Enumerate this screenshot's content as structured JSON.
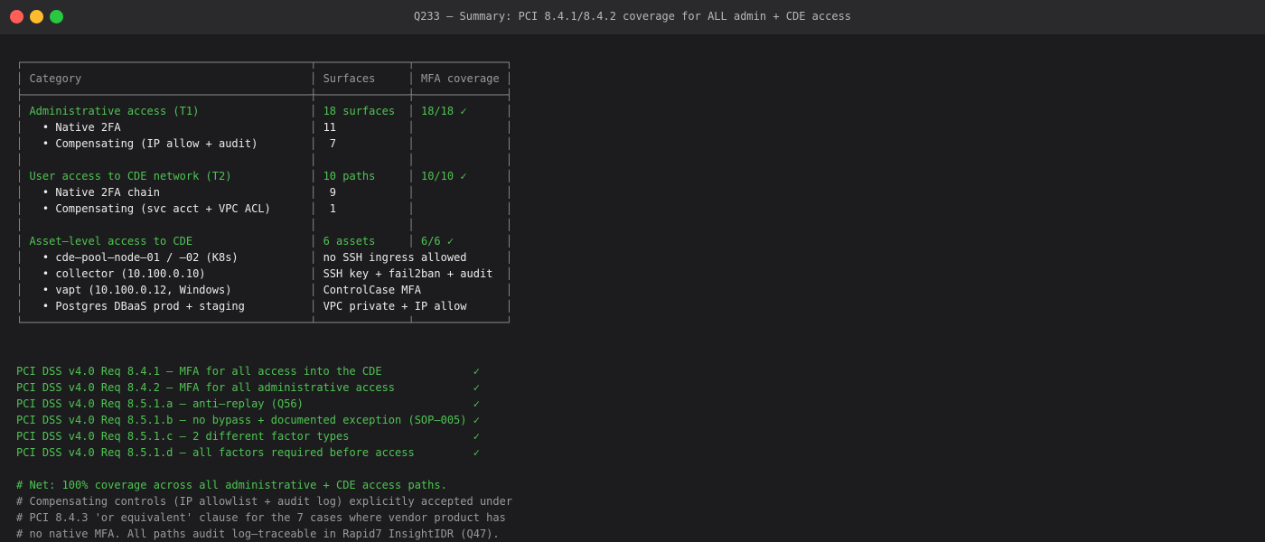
{
  "window": {
    "title": "Q233 — Summary: PCI 8.4.1/8.4.2 coverage for ALL admin + CDE access",
    "controls": {
      "close_color": "#ff5f57",
      "minimize_color": "#febc2e",
      "zoom_color": "#28c840"
    }
  },
  "colors": {
    "accent_green": "#4ec452",
    "text": "#ececec",
    "comment": "#9a9a9a",
    "background": "#1c1c1e"
  },
  "table": {
    "headers": [
      "Category",
      "Surfaces",
      "MFA coverage"
    ],
    "groups": [
      {
        "category": "Administrative access (T1)",
        "surfaces": "18 surfaces",
        "coverage": "18/18 ✓",
        "items": [
          {
            "label": "• Native 2FA",
            "value": "11"
          },
          {
            "label": "• Compensating (IP allow + audit)",
            "value": " 7"
          }
        ]
      },
      {
        "category": "User access to CDE network (T2)",
        "surfaces": "10 paths",
        "coverage": "10/10 ✓",
        "items": [
          {
            "label": "• Native 2FA chain",
            "value": " 9"
          },
          {
            "label": "• Compensating (svc acct + VPC ACL)",
            "value": " 1"
          }
        ]
      },
      {
        "category": "Asset–level access to CDE",
        "surfaces": "6 assets",
        "coverage": "6/6 ✓",
        "items": [
          {
            "label": "• cde–pool–node–01 / –02 (K8s)",
            "value": "no SSH ingress allowed"
          },
          {
            "label": "• collector (10.100.0.10)",
            "value": "SSH key + fail2ban + audit"
          },
          {
            "label": "• vapt (10.100.0.12, Windows)",
            "value": "ControlCase MFA"
          },
          {
            "label": "• Postgres DBaaS prod + staging",
            "value": "VPC private + IP allow"
          }
        ]
      }
    ]
  },
  "requirements": [
    {
      "text": "PCI DSS v4.0 Req 8.4.1 – MFA for all access into the CDE",
      "status": "✓"
    },
    {
      "text": "PCI DSS v4.0 Req 8.4.2 – MFA for all administrative access",
      "status": "✓"
    },
    {
      "text": "PCI DSS v4.0 Req 8.5.1.a – anti–replay (Q56)",
      "status": "✓"
    },
    {
      "text": "PCI DSS v4.0 Req 8.5.1.b – no bypass + documented exception (SOP–005)",
      "status": "✓"
    },
    {
      "text": "PCI DSS v4.0 Req 8.5.1.c – 2 different factor types",
      "status": "✓"
    },
    {
      "text": "PCI DSS v4.0 Req 8.5.1.d – all factors required before access",
      "status": "✓"
    }
  ],
  "notes": {
    "net": "# Net: 100% coverage across all administrative + CDE access paths.",
    "comments": [
      "# Compensating controls (IP allowlist + audit log) explicitly accepted under",
      "# PCI 8.4.3 'or equivalent' clause for the 7 cases where vendor product has",
      "# no native MFA. All paths audit log–traceable in Rapid7 InsightIDR (Q47)."
    ]
  }
}
